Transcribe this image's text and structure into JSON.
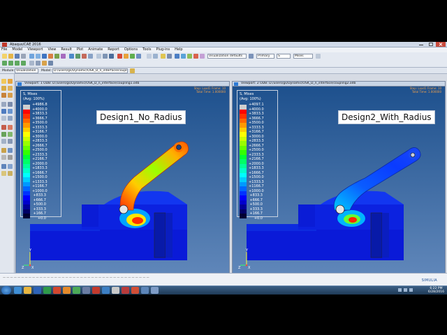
{
  "window": {
    "title": "Abaqus/CAE 2016"
  },
  "menu": [
    "File",
    "Model",
    "Viewport",
    "View",
    "Result",
    "Plot",
    "Animate",
    "Report",
    "Options",
    "Tools",
    "Plug-ins",
    "Help"
  ],
  "toolbar": {
    "render_style": "Visualization defaults",
    "primary": "Primary",
    "field": "S",
    "invariant": "Mises"
  },
  "context": {
    "module_label": "Module:",
    "module_value": "Visualization",
    "model_label": "Model:",
    "model_value": "D:/users/gs/Dynamic/OSK_D_n_interface/coupling1.odb"
  },
  "viewports": [
    {
      "title": "Viewport: 1   ODB: D:/users/gs/Dynamic/OSK_D_n_interface/coupling1.odb",
      "design_label": "Design1_No_Radius",
      "legend_title": "S, Mises",
      "legend_subtitle": "(Avg: 100%)",
      "legend_values": [
        "4986.8",
        "4000.0",
        "3833.3",
        "3666.7",
        "3500.0",
        "3333.3",
        "3166.7",
        "3000.0",
        "2833.3",
        "2666.7",
        "2500.0",
        "2333.3",
        "2166.7",
        "2000.0",
        "1833.3",
        "1666.7",
        "1500.0",
        "1333.3",
        "1166.7",
        "1000.0",
        "833.3",
        "666.7",
        "500.0",
        "333.3",
        "166.7",
        "0.0"
      ],
      "step_info": [
        "Step: Load1   Frame: 10",
        "Total Time: 1.000000"
      ]
    },
    {
      "title": "Viewport: 2   ODB: D:/users/gs/Dynamic/OSK_D_n_interface/coupling2.odb",
      "design_label": "Design2_With_Radius",
      "legend_title": "S, Mises",
      "legend_subtitle": "(Avg: 100%)",
      "legend_values": [
        "4097.1",
        "4000.0",
        "3833.3",
        "3666.7",
        "3500.0",
        "3333.3",
        "3166.7",
        "3000.0",
        "2833.3",
        "2666.7",
        "2500.0",
        "2333.3",
        "2166.7",
        "2000.0",
        "1833.3",
        "1666.7",
        "1500.0",
        "1333.3",
        "1166.7",
        "1000.0",
        "833.3",
        "666.7",
        "500.0",
        "333.3",
        "166.7",
        "0.0"
      ],
      "step_info": [
        "Step: Load1   Frame: 10",
        "Total Time: 1.000000"
      ]
    }
  ],
  "legend_colors": [
    "#cfcfcf",
    "#ff0000",
    "#ff3300",
    "#ff6600",
    "#ff9900",
    "#ffcc00",
    "#ffff00",
    "#ccff00",
    "#99ff00",
    "#66ff00",
    "#33ff00",
    "#00ff33",
    "#00ff66",
    "#00ff99",
    "#00ffcc",
    "#00ffff",
    "#00ccff",
    "#0099ff",
    "#0066ff",
    "#0033ff",
    "#0000ff",
    "#0000cc",
    "#000099",
    "#000066",
    "#000033"
  ],
  "triad": {
    "y": "Y",
    "z": "Z",
    "x": "X"
  },
  "brand": "SIMULIA",
  "clock": {
    "time": "6:22 PM",
    "date": "6/28/2016"
  }
}
